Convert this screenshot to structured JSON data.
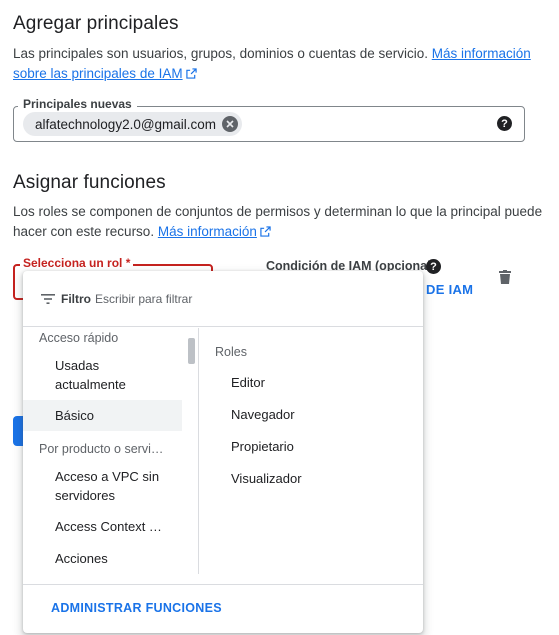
{
  "principals": {
    "title": "Agregar principales",
    "description": "Las principales son usuarios, grupos, dominios o cuentas de servicio.",
    "link_line1": "Más información",
    "link_line2": "sobre las principales de IAM",
    "field_label": "Principales nuevas",
    "chip_value": "alfatechnology2.0@gmail.com"
  },
  "roles": {
    "title": "Asignar funciones",
    "description_line1": "Los roles se componen de conjuntos de permisos y determinan lo que la principal puede",
    "description_line2": "hacer con este recurso.",
    "link": "Más información",
    "select_label": "Selecciona un rol *",
    "condition_label": "Condición de IAM (opcional)",
    "condition_link": "DE IAM"
  },
  "dropdown": {
    "filter_label": "Filtro",
    "filter_placeholder": "Escribir para filtrar",
    "groups": [
      {
        "label": "Acceso rápido",
        "items": [
          "Usadas actualmente",
          "Básico"
        ]
      },
      {
        "label": "Por producto o servi…",
        "items": [
          "Acceso a VPC sin servidores",
          "Access Context …",
          "Acciones"
        ]
      }
    ],
    "selected_item": "Básico",
    "roles_heading": "Roles",
    "roles": [
      "Editor",
      "Navegador",
      "Propietario",
      "Visualizador"
    ],
    "manage_button": "ADMINISTRAR FUNCIONES"
  },
  "icons": {
    "external_link": "open-in-new-icon",
    "chip_remove": "cancel-icon",
    "help": "help-icon",
    "delete": "trash-icon",
    "filter": "filter-list-icon"
  },
  "colors": {
    "accent": "#1a73e8",
    "error": "#c5221f"
  }
}
